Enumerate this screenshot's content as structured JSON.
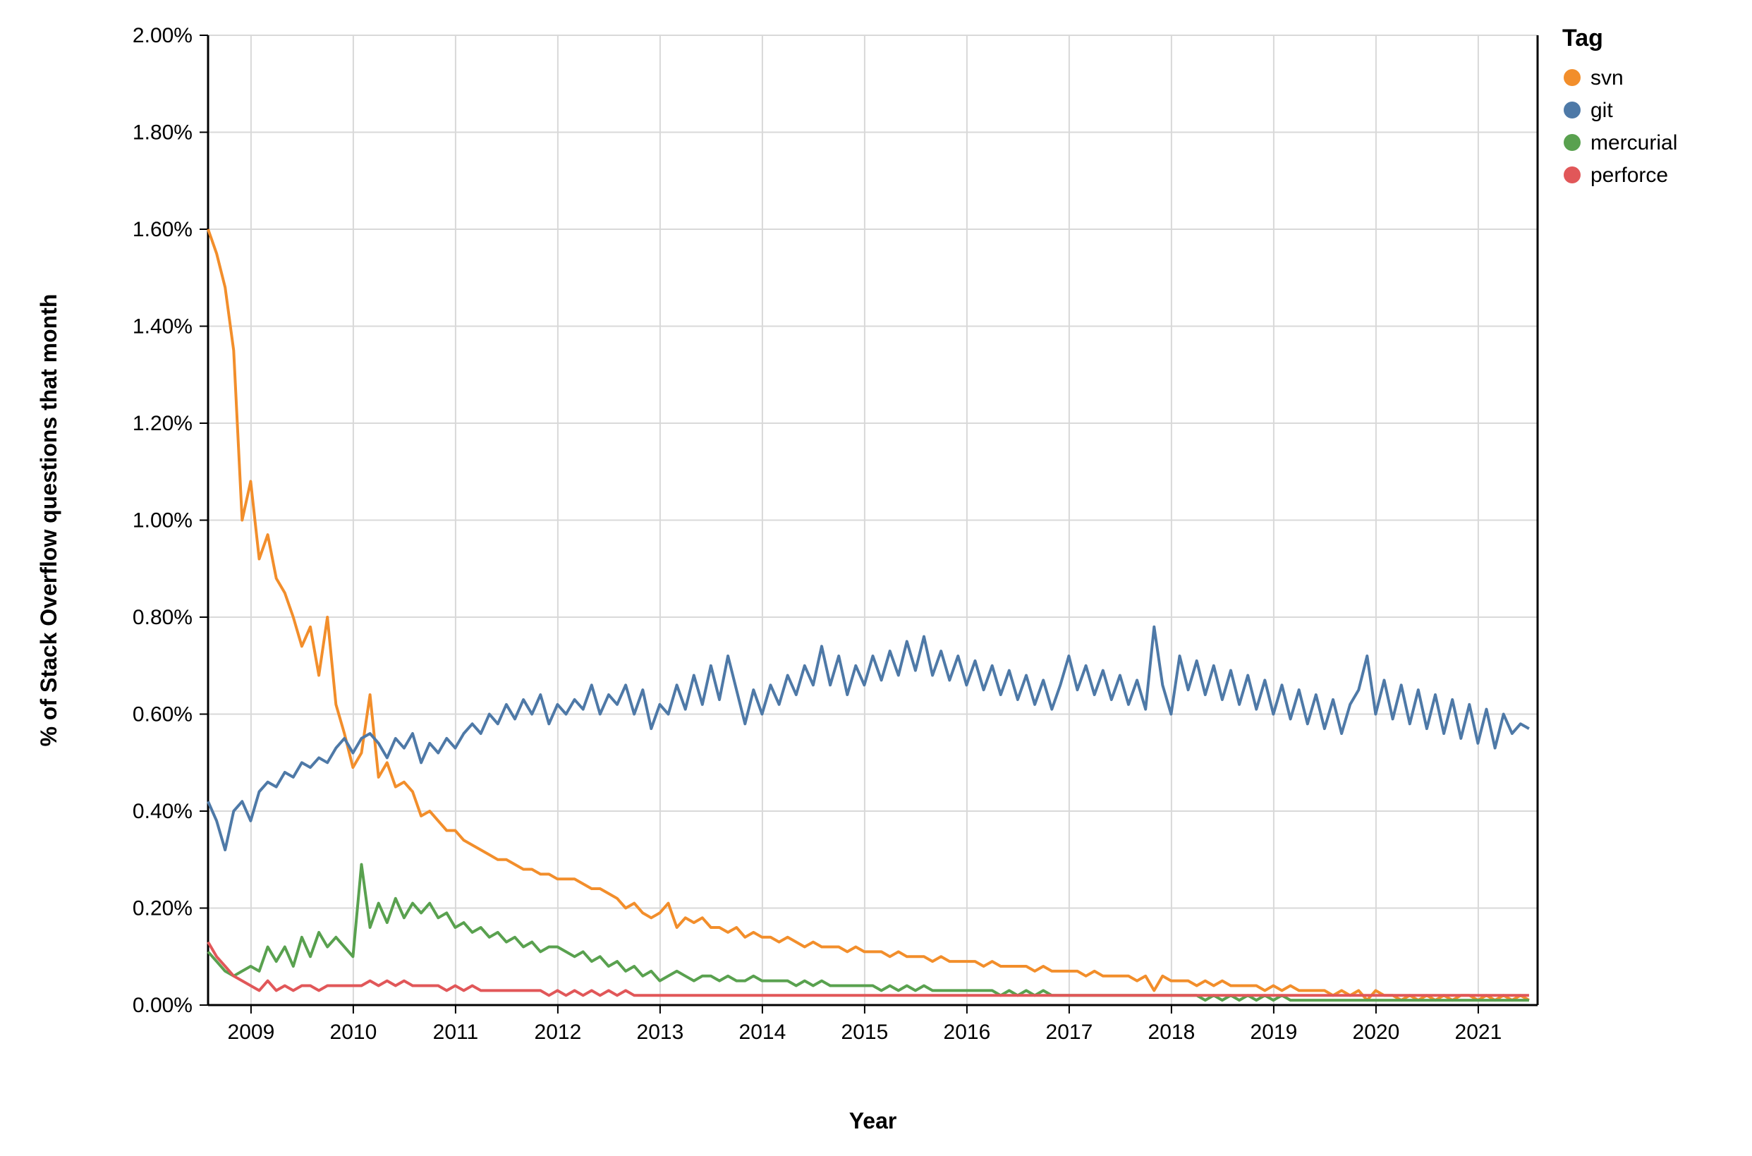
{
  "chart_data": {
    "type": "line",
    "xlabel": "Year",
    "ylabel": "% of Stack Overflow questions that month",
    "legend_title": "Tag",
    "ylim": [
      0,
      2.0
    ],
    "y_ticks": [
      0.0,
      0.2,
      0.4,
      0.6,
      0.8,
      1.0,
      1.2,
      1.4,
      1.6,
      1.8,
      2.0
    ],
    "y_tick_labels": [
      "0.00%",
      "0.20%",
      "0.40%",
      "0.60%",
      "0.80%",
      "1.00%",
      "1.20%",
      "1.40%",
      "1.60%",
      "1.80%",
      "2.00%"
    ],
    "x_tick_years": [
      2009,
      2010,
      2011,
      2012,
      2013,
      2014,
      2015,
      2016,
      2017,
      2018,
      2019,
      2020,
      2021
    ],
    "x_start": 2008.58,
    "x_end": 2021.58,
    "series": [
      {
        "name": "svn",
        "color": "#f28e2b",
        "start_year": 2008.58,
        "step_months": 1,
        "values": [
          1.6,
          1.55,
          1.48,
          1.35,
          1.0,
          1.08,
          0.92,
          0.97,
          0.88,
          0.85,
          0.8,
          0.74,
          0.78,
          0.68,
          0.8,
          0.62,
          0.56,
          0.49,
          0.52,
          0.64,
          0.47,
          0.5,
          0.45,
          0.46,
          0.44,
          0.39,
          0.4,
          0.38,
          0.36,
          0.36,
          0.34,
          0.33,
          0.32,
          0.31,
          0.3,
          0.3,
          0.29,
          0.28,
          0.28,
          0.27,
          0.27,
          0.26,
          0.26,
          0.26,
          0.25,
          0.24,
          0.24,
          0.23,
          0.22,
          0.2,
          0.21,
          0.19,
          0.18,
          0.19,
          0.21,
          0.16,
          0.18,
          0.17,
          0.18,
          0.16,
          0.16,
          0.15,
          0.16,
          0.14,
          0.15,
          0.14,
          0.14,
          0.13,
          0.14,
          0.13,
          0.12,
          0.13,
          0.12,
          0.12,
          0.12,
          0.11,
          0.12,
          0.11,
          0.11,
          0.11,
          0.1,
          0.11,
          0.1,
          0.1,
          0.1,
          0.09,
          0.1,
          0.09,
          0.09,
          0.09,
          0.09,
          0.08,
          0.09,
          0.08,
          0.08,
          0.08,
          0.08,
          0.07,
          0.08,
          0.07,
          0.07,
          0.07,
          0.07,
          0.06,
          0.07,
          0.06,
          0.06,
          0.06,
          0.06,
          0.05,
          0.06,
          0.03,
          0.06,
          0.05,
          0.05,
          0.05,
          0.04,
          0.05,
          0.04,
          0.05,
          0.04,
          0.04,
          0.04,
          0.04,
          0.03,
          0.04,
          0.03,
          0.04,
          0.03,
          0.03,
          0.03,
          0.03,
          0.02,
          0.03,
          0.02,
          0.03,
          0.01,
          0.03,
          0.02,
          0.02,
          0.01,
          0.02,
          0.01,
          0.02,
          0.01,
          0.02,
          0.01,
          0.02,
          0.02,
          0.01,
          0.02,
          0.01,
          0.02,
          0.01,
          0.02,
          0.01
        ]
      },
      {
        "name": "git",
        "color": "#4e79a7",
        "start_year": 2008.58,
        "step_months": 1,
        "values": [
          0.42,
          0.38,
          0.32,
          0.4,
          0.42,
          0.38,
          0.44,
          0.46,
          0.45,
          0.48,
          0.47,
          0.5,
          0.49,
          0.51,
          0.5,
          0.53,
          0.55,
          0.52,
          0.55,
          0.56,
          0.54,
          0.51,
          0.55,
          0.53,
          0.56,
          0.5,
          0.54,
          0.52,
          0.55,
          0.53,
          0.56,
          0.58,
          0.56,
          0.6,
          0.58,
          0.62,
          0.59,
          0.63,
          0.6,
          0.64,
          0.58,
          0.62,
          0.6,
          0.63,
          0.61,
          0.66,
          0.6,
          0.64,
          0.62,
          0.66,
          0.6,
          0.65,
          0.57,
          0.62,
          0.6,
          0.66,
          0.61,
          0.68,
          0.62,
          0.7,
          0.63,
          0.72,
          0.65,
          0.58,
          0.65,
          0.6,
          0.66,
          0.62,
          0.68,
          0.64,
          0.7,
          0.66,
          0.74,
          0.66,
          0.72,
          0.64,
          0.7,
          0.66,
          0.72,
          0.67,
          0.73,
          0.68,
          0.75,
          0.69,
          0.76,
          0.68,
          0.73,
          0.67,
          0.72,
          0.66,
          0.71,
          0.65,
          0.7,
          0.64,
          0.69,
          0.63,
          0.68,
          0.62,
          0.67,
          0.61,
          0.66,
          0.72,
          0.65,
          0.7,
          0.64,
          0.69,
          0.63,
          0.68,
          0.62,
          0.67,
          0.61,
          0.78,
          0.66,
          0.6,
          0.72,
          0.65,
          0.71,
          0.64,
          0.7,
          0.63,
          0.69,
          0.62,
          0.68,
          0.61,
          0.67,
          0.6,
          0.66,
          0.59,
          0.65,
          0.58,
          0.64,
          0.57,
          0.63,
          0.56,
          0.62,
          0.65,
          0.72,
          0.6,
          0.67,
          0.59,
          0.66,
          0.58,
          0.65,
          0.57,
          0.64,
          0.56,
          0.63,
          0.55,
          0.62,
          0.54,
          0.61,
          0.53,
          0.6,
          0.56,
          0.58,
          0.57
        ]
      },
      {
        "name": "mercurial",
        "color": "#59a14f",
        "start_year": 2008.58,
        "step_months": 1,
        "values": [
          0.11,
          0.09,
          0.07,
          0.06,
          0.07,
          0.08,
          0.07,
          0.12,
          0.09,
          0.12,
          0.08,
          0.14,
          0.1,
          0.15,
          0.12,
          0.14,
          0.12,
          0.1,
          0.29,
          0.16,
          0.21,
          0.17,
          0.22,
          0.18,
          0.21,
          0.19,
          0.21,
          0.18,
          0.19,
          0.16,
          0.17,
          0.15,
          0.16,
          0.14,
          0.15,
          0.13,
          0.14,
          0.12,
          0.13,
          0.11,
          0.12,
          0.12,
          0.11,
          0.1,
          0.11,
          0.09,
          0.1,
          0.08,
          0.09,
          0.07,
          0.08,
          0.06,
          0.07,
          0.05,
          0.06,
          0.07,
          0.06,
          0.05,
          0.06,
          0.06,
          0.05,
          0.06,
          0.05,
          0.05,
          0.06,
          0.05,
          0.05,
          0.05,
          0.05,
          0.04,
          0.05,
          0.04,
          0.05,
          0.04,
          0.04,
          0.04,
          0.04,
          0.04,
          0.04,
          0.03,
          0.04,
          0.03,
          0.04,
          0.03,
          0.04,
          0.03,
          0.03,
          0.03,
          0.03,
          0.03,
          0.03,
          0.03,
          0.03,
          0.02,
          0.03,
          0.02,
          0.03,
          0.02,
          0.03,
          0.02,
          0.02,
          0.02,
          0.02,
          0.02,
          0.02,
          0.02,
          0.02,
          0.02,
          0.02,
          0.02,
          0.02,
          0.02,
          0.02,
          0.02,
          0.02,
          0.02,
          0.02,
          0.01,
          0.02,
          0.01,
          0.02,
          0.01,
          0.02,
          0.01,
          0.02,
          0.01,
          0.02,
          0.01,
          0.01,
          0.01,
          0.01,
          0.01,
          0.01,
          0.01,
          0.01,
          0.01,
          0.01,
          0.01,
          0.01,
          0.01,
          0.01,
          0.01,
          0.01,
          0.01,
          0.01,
          0.01,
          0.01,
          0.01,
          0.01,
          0.01,
          0.01,
          0.01,
          0.01,
          0.01,
          0.01,
          0.01
        ]
      },
      {
        "name": "perforce",
        "color": "#e15759",
        "start_year": 2008.58,
        "step_months": 1,
        "values": [
          0.13,
          0.1,
          0.08,
          0.06,
          0.05,
          0.04,
          0.03,
          0.05,
          0.03,
          0.04,
          0.03,
          0.04,
          0.04,
          0.03,
          0.04,
          0.04,
          0.04,
          0.04,
          0.04,
          0.05,
          0.04,
          0.05,
          0.04,
          0.05,
          0.04,
          0.04,
          0.04,
          0.04,
          0.03,
          0.04,
          0.03,
          0.04,
          0.03,
          0.03,
          0.03,
          0.03,
          0.03,
          0.03,
          0.03,
          0.03,
          0.02,
          0.03,
          0.02,
          0.03,
          0.02,
          0.03,
          0.02,
          0.03,
          0.02,
          0.03,
          0.02,
          0.02,
          0.02,
          0.02,
          0.02,
          0.02,
          0.02,
          0.02,
          0.02,
          0.02,
          0.02,
          0.02,
          0.02,
          0.02,
          0.02,
          0.02,
          0.02,
          0.02,
          0.02,
          0.02,
          0.02,
          0.02,
          0.02,
          0.02,
          0.02,
          0.02,
          0.02,
          0.02,
          0.02,
          0.02,
          0.02,
          0.02,
          0.02,
          0.02,
          0.02,
          0.02,
          0.02,
          0.02,
          0.02,
          0.02,
          0.02,
          0.02,
          0.02,
          0.02,
          0.02,
          0.02,
          0.02,
          0.02,
          0.02,
          0.02,
          0.02,
          0.02,
          0.02,
          0.02,
          0.02,
          0.02,
          0.02,
          0.02,
          0.02,
          0.02,
          0.02,
          0.02,
          0.02,
          0.02,
          0.02,
          0.02,
          0.02,
          0.02,
          0.02,
          0.02,
          0.02,
          0.02,
          0.02,
          0.02,
          0.02,
          0.02,
          0.02,
          0.02,
          0.02,
          0.02,
          0.02,
          0.02,
          0.02,
          0.02,
          0.02,
          0.02,
          0.02,
          0.02,
          0.02,
          0.02,
          0.02,
          0.02,
          0.02,
          0.02,
          0.02,
          0.02,
          0.02,
          0.02,
          0.02,
          0.02,
          0.02,
          0.02,
          0.02,
          0.02,
          0.02,
          0.02
        ]
      }
    ]
  }
}
